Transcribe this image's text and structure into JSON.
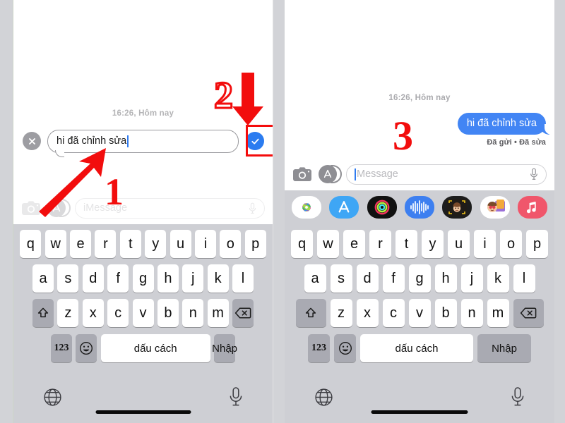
{
  "meta": {
    "app": "iMessage",
    "language": "vi",
    "accent_blue": "#2b7cf0",
    "bubble_blue": "#4285f4",
    "annotation_red": "#f20d0d",
    "keyboard_bg": "#cecfd4",
    "key_white": "#ffffff",
    "key_dark": "#a9aab2"
  },
  "annotations": [
    {
      "label": "1",
      "style": "solid",
      "arrow": "up-right",
      "target": "edit-text-field"
    },
    {
      "label": "2",
      "style": "outline",
      "arrow": "down",
      "target": "confirm-edit-button"
    },
    {
      "label": "3",
      "style": "solid",
      "arrow": "none",
      "target": "edited-message-bubble"
    }
  ],
  "left_panel": {
    "timestamp": "16:26, Hôm nay",
    "edit_field": {
      "value": "hi đã chỉnh sửa",
      "cancel_icon": "close-icon",
      "confirm_icon": "checkmark-icon"
    },
    "toolbar": {
      "camera_icon": "camera-icon",
      "appstore_icon": "app-store-icon",
      "placeholder": "iMessage",
      "mic_icon": "microphone-icon"
    }
  },
  "right_panel": {
    "timestamp": "16:26, Hôm nay",
    "message": {
      "text": "hi đã chỉnh sửa",
      "status": "Đã gửi • Đã sửa"
    },
    "toolbar": {
      "camera_icon": "camera-icon",
      "appstore_icon": "app-store-icon",
      "placeholder": "Message",
      "mic_icon": "microphone-icon"
    },
    "app_drawer": [
      {
        "name": "photos-app-icon",
        "color": "#ffffff"
      },
      {
        "name": "app-store-app-icon",
        "color": "#3ea6f5"
      },
      {
        "name": "fitness-activity-app-icon",
        "color": "#111111"
      },
      {
        "name": "voice-memo-app-icon",
        "color": "#3d7ff0"
      },
      {
        "name": "memoji-app-icon",
        "color": "#1d1d1d"
      },
      {
        "name": "memoji-stickers-app-icon",
        "color": "#ffffff"
      },
      {
        "name": "apple-music-app-icon",
        "color": "#f0566b"
      }
    ]
  },
  "keyboard": {
    "row1": [
      "q",
      "w",
      "e",
      "r",
      "t",
      "y",
      "u",
      "i",
      "o",
      "p"
    ],
    "row2": [
      "a",
      "s",
      "d",
      "f",
      "g",
      "h",
      "j",
      "k",
      "l"
    ],
    "row3": [
      "z",
      "x",
      "c",
      "v",
      "b",
      "n",
      "m"
    ],
    "shift_icon": "shift-icon",
    "backspace_icon": "backspace-icon",
    "numbers_key": "123",
    "emoji_key": "emoji-icon",
    "space_key": "dấu cách",
    "enter_key": "Nhập",
    "globe_icon": "globe-icon",
    "dictation_icon": "microphone-icon"
  }
}
